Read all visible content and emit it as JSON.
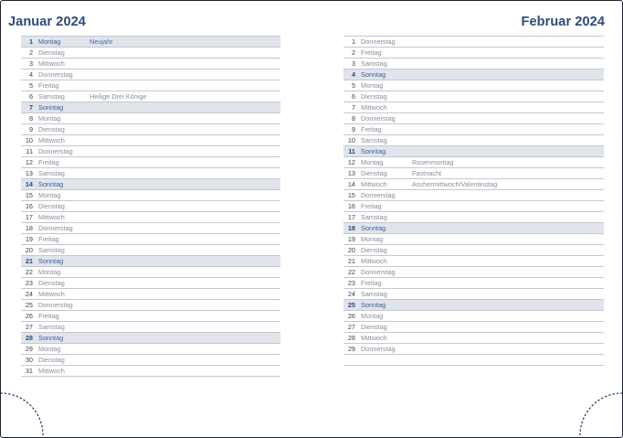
{
  "left_page": {
    "month_title": "Januar 2024",
    "days": [
      {
        "num": "1",
        "day": "Montag",
        "note": "Neujahr",
        "sunday": true,
        "holiday": true
      },
      {
        "num": "2",
        "day": "Dienstag",
        "note": ""
      },
      {
        "num": "3",
        "day": "Mittwoch",
        "note": ""
      },
      {
        "num": "4",
        "day": "Donnerstag",
        "note": ""
      },
      {
        "num": "5",
        "day": "Freitag",
        "note": ""
      },
      {
        "num": "6",
        "day": "Samstag",
        "note": "Heilige Drei Könige"
      },
      {
        "num": "7",
        "day": "Sonntag",
        "note": "",
        "sunday": true
      },
      {
        "num": "8",
        "day": "Montag",
        "note": ""
      },
      {
        "num": "9",
        "day": "Dienstag",
        "note": ""
      },
      {
        "num": "10",
        "day": "Mittwoch",
        "note": ""
      },
      {
        "num": "11",
        "day": "Donnerstag",
        "note": ""
      },
      {
        "num": "12",
        "day": "Freitag",
        "note": ""
      },
      {
        "num": "13",
        "day": "Samstag",
        "note": ""
      },
      {
        "num": "14",
        "day": "Sonntag",
        "note": "",
        "sunday": true
      },
      {
        "num": "15",
        "day": "Montag",
        "note": ""
      },
      {
        "num": "16",
        "day": "Dienstag",
        "note": ""
      },
      {
        "num": "17",
        "day": "Mittwoch",
        "note": ""
      },
      {
        "num": "18",
        "day": "Donnerstag",
        "note": ""
      },
      {
        "num": "19",
        "day": "Freitag",
        "note": ""
      },
      {
        "num": "20",
        "day": "Samstag",
        "note": ""
      },
      {
        "num": "21",
        "day": "Sonntag",
        "note": "",
        "sunday": true
      },
      {
        "num": "22",
        "day": "Montag",
        "note": ""
      },
      {
        "num": "23",
        "day": "Dienstag",
        "note": ""
      },
      {
        "num": "24",
        "day": "Mittwoch",
        "note": ""
      },
      {
        "num": "25",
        "day": "Donnerstag",
        "note": ""
      },
      {
        "num": "26",
        "day": "Freitag",
        "note": ""
      },
      {
        "num": "27",
        "day": "Samstag",
        "note": ""
      },
      {
        "num": "28",
        "day": "Sonntag",
        "note": "",
        "sunday": true
      },
      {
        "num": "29",
        "day": "Montag",
        "note": ""
      },
      {
        "num": "30",
        "day": "Dienstag",
        "note": ""
      },
      {
        "num": "31",
        "day": "Mittwoch",
        "note": ""
      }
    ]
  },
  "right_page": {
    "month_title": "Februar 2024",
    "days": [
      {
        "num": "1",
        "day": "Donnerstag",
        "note": ""
      },
      {
        "num": "2",
        "day": "Freitag",
        "note": ""
      },
      {
        "num": "3",
        "day": "Samstag",
        "note": ""
      },
      {
        "num": "4",
        "day": "Sonntag",
        "note": "",
        "sunday": true
      },
      {
        "num": "5",
        "day": "Montag",
        "note": ""
      },
      {
        "num": "6",
        "day": "Dienstag",
        "note": ""
      },
      {
        "num": "7",
        "day": "Mittwoch",
        "note": ""
      },
      {
        "num": "8",
        "day": "Donnerstag",
        "note": ""
      },
      {
        "num": "9",
        "day": "Freitag",
        "note": ""
      },
      {
        "num": "10",
        "day": "Samstag",
        "note": ""
      },
      {
        "num": "11",
        "day": "Sonntag",
        "note": "",
        "sunday": true
      },
      {
        "num": "12",
        "day": "Montag",
        "note": "Rosenmontag"
      },
      {
        "num": "13",
        "day": "Dienstag",
        "note": "Fastnacht"
      },
      {
        "num": "14",
        "day": "Mittwoch",
        "note": "Aschermittwoch/Valentinstag"
      },
      {
        "num": "15",
        "day": "Donnerstag",
        "note": ""
      },
      {
        "num": "16",
        "day": "Freitag",
        "note": ""
      },
      {
        "num": "17",
        "day": "Samstag",
        "note": ""
      },
      {
        "num": "18",
        "day": "Sonntag",
        "note": "",
        "sunday": true
      },
      {
        "num": "19",
        "day": "Montag",
        "note": ""
      },
      {
        "num": "20",
        "day": "Dienstag",
        "note": ""
      },
      {
        "num": "21",
        "day": "Mittwoch",
        "note": ""
      },
      {
        "num": "22",
        "day": "Donnerstag",
        "note": ""
      },
      {
        "num": "23",
        "day": "Freitag",
        "note": ""
      },
      {
        "num": "24",
        "day": "Samstag",
        "note": ""
      },
      {
        "num": "25",
        "day": "Sonntag",
        "note": "",
        "sunday": true
      },
      {
        "num": "26",
        "day": "Montag",
        "note": ""
      },
      {
        "num": "27",
        "day": "Dienstag",
        "note": ""
      },
      {
        "num": "28",
        "day": "Mittwoch",
        "note": ""
      },
      {
        "num": "29",
        "day": "Donnerstag",
        "note": ""
      },
      {
        "num": "",
        "day": "",
        "note": "",
        "blank": true
      }
    ]
  },
  "decorations": {
    "corner_left_icon": "dotted-arc-icon",
    "corner_right_icon": "dotted-arc-icon"
  },
  "colors": {
    "title": "#2e4a7a",
    "sunday_shading": "#e1e4ea",
    "sunday_text": "#3d5ea3",
    "weekday_text": "#8a8f97",
    "rule_lines": "#c3c8d1",
    "frame": "#1b2535"
  }
}
